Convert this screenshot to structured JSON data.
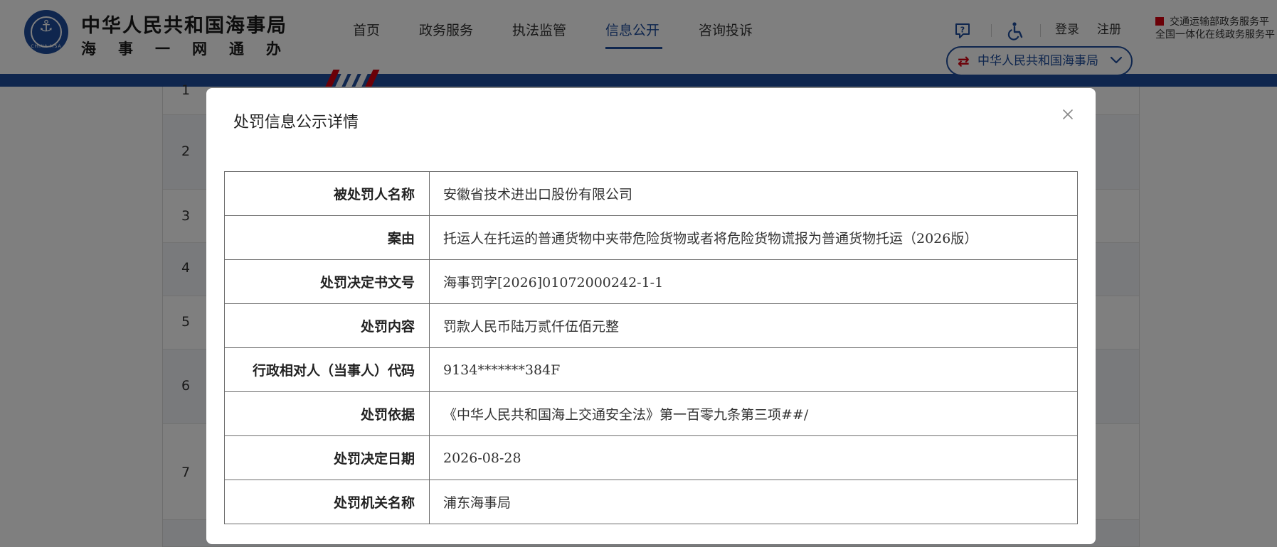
{
  "header": {
    "site_title": "中华人民共和国海事局",
    "site_subtitle": "海事一网通办",
    "seal_text": "CHINA MSA",
    "nav": [
      {
        "label": "首页",
        "active": false
      },
      {
        "label": "政务服务",
        "active": false
      },
      {
        "label": "执法监管",
        "active": false
      },
      {
        "label": "信息公开",
        "active": true
      },
      {
        "label": "咨询投诉",
        "active": false
      }
    ],
    "help_icon": "help-chat-icon",
    "accessibility_icon": "wheelchair-icon",
    "login_label": "登录",
    "register_label": "注册",
    "gov_link_line1": "交通运输部政务服务平",
    "gov_link_line2": "全国一体化在线政务服务平",
    "org_select_label": "中华人民共和国海事局",
    "colors": {
      "brand_blue": "#1e4d9c",
      "accent_red": "#d7000f"
    }
  },
  "background_table": {
    "row_numbers": [
      "1",
      "2",
      "3",
      "4",
      "5",
      "6",
      "7"
    ]
  },
  "dialog": {
    "title": "处罚信息公示详情",
    "close_icon": "close-icon",
    "rows": [
      {
        "label": "被处罚人名称",
        "value": "安徽省技术进出口股份有限公司"
      },
      {
        "label": "案由",
        "value": "托运人在托运的普通货物中夹带危险货物或者将危险货物谎报为普通货物托运（2026版）"
      },
      {
        "label": "处罚决定书文号",
        "value": "海事罚字[2026]01072000242-1-1"
      },
      {
        "label": "处罚内容",
        "value": "罚款人民币陆万贰仟伍佰元整"
      },
      {
        "label": "行政相对人（当事人）代码",
        "value": "9134*******384F"
      },
      {
        "label": "处罚依据",
        "value": "《中华人民共和国海上交通安全法》第一百零九条第三项##/"
      },
      {
        "label": "处罚决定日期",
        "value": "2026-08-28"
      },
      {
        "label": "处罚机关名称",
        "value": "浦东海事局"
      }
    ]
  }
}
